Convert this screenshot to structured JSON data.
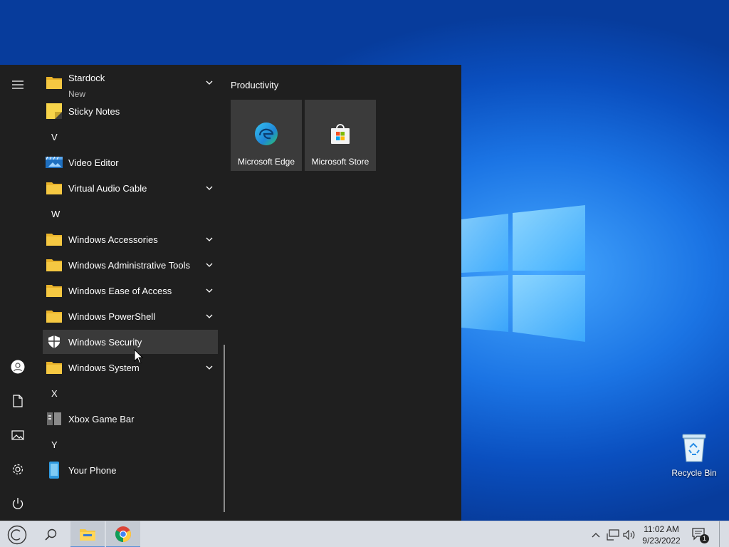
{
  "start_menu": {
    "apps": [
      {
        "label": "Stardock",
        "sub": "New",
        "type": "folder",
        "expand": true
      },
      {
        "label": "Sticky Notes",
        "type": "sticky"
      },
      {
        "letter": "V"
      },
      {
        "label": "Video Editor",
        "type": "video"
      },
      {
        "label": "Virtual Audio Cable",
        "type": "folder",
        "expand": true
      },
      {
        "letter": "W"
      },
      {
        "label": "Windows Accessories",
        "type": "folder",
        "expand": true
      },
      {
        "label": "Windows Administrative Tools",
        "type": "folder",
        "expand": true
      },
      {
        "label": "Windows Ease of Access",
        "type": "folder",
        "expand": true
      },
      {
        "label": "Windows PowerShell",
        "type": "folder",
        "expand": true
      },
      {
        "label": "Windows Security",
        "type": "shield",
        "hovered": true
      },
      {
        "label": "Windows System",
        "type": "folder",
        "expand": true
      },
      {
        "letter": "X"
      },
      {
        "label": "Xbox Game Bar",
        "type": "xbox"
      },
      {
        "letter": "Y"
      },
      {
        "label": "Your Phone",
        "type": "phone"
      }
    ],
    "tile_group": "Productivity",
    "tiles": [
      {
        "label": "Microsoft Edge",
        "icon": "edge-icon"
      },
      {
        "label": "Microsoft Store",
        "icon": "store-icon"
      }
    ],
    "rail_icons": [
      "hamburger-menu-icon",
      "user-account-icon",
      "documents-icon",
      "pictures-icon",
      "settings-gear-icon",
      "power-icon"
    ]
  },
  "desktop": {
    "recycle_bin": "Recycle Bin"
  },
  "taskbar": {
    "time": "11:02 AM",
    "date": "9/23/2022",
    "notification_count": "1"
  },
  "colors": {
    "menu_bg": "#1f1f1f",
    "tile_bg": "#3b3b3b",
    "hover_bg": "#3a3a3a",
    "taskbar_bg": "#d9dde4",
    "folder": "#f5c842"
  }
}
